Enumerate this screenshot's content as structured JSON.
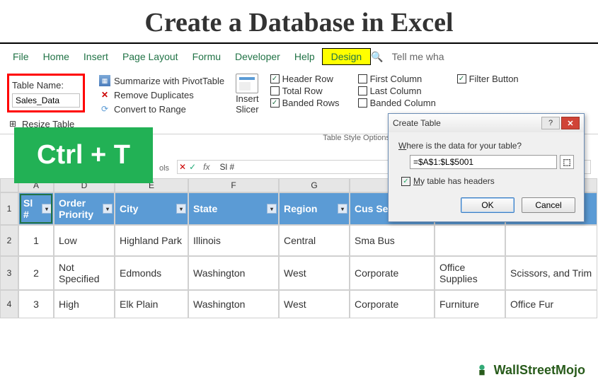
{
  "title": "Create a Database in Excel",
  "ribbon_tabs": [
    "File",
    "Home",
    "Insert",
    "Page Layout",
    "Formu",
    "Developer",
    "Help",
    "Design"
  ],
  "tellme": "Tell me wha",
  "table_name": {
    "label": "Table Name:",
    "value": "Sales_Data",
    "resize": "Resize Table"
  },
  "tools": {
    "pivot": "Summarize with PivotTable",
    "dup": "Remove Duplicates",
    "range": "Convert to Range",
    "group": "ols"
  },
  "slicer": {
    "top": "Insert",
    "bottom": "Slicer"
  },
  "style_options": {
    "header_row": "Header Row",
    "total_row": "Total Row",
    "banded_rows": "Banded Rows",
    "first_col": "First Column",
    "last_col": "Last Column",
    "banded_col": "Banded Column",
    "filter_btn": "Filter Button",
    "group": "Table Style Options"
  },
  "shortcut": "Ctrl + T",
  "formula": {
    "fx": "fx",
    "value": "Sl #"
  },
  "col_letters": [
    "A",
    "D",
    "E",
    "F",
    "G"
  ],
  "row_nums": [
    "1",
    "2",
    "3",
    "4"
  ],
  "headers": [
    "Sl #",
    "Order Priority",
    "City",
    "State",
    "Region",
    "Cus\nSeg",
    "",
    ""
  ],
  "rows": [
    [
      "1",
      "Low",
      "Highland Park",
      "Illinois",
      "Central",
      "Sma\nBus",
      "",
      ""
    ],
    [
      "2",
      "Not Specified",
      "Edmonds",
      "Washington",
      "West",
      "Corporate",
      "Office Supplies",
      "Scissors, and Trim"
    ],
    [
      "3",
      "High",
      "Elk Plain",
      "Washington",
      "West",
      "Corporate",
      "Furniture",
      "Office Fur"
    ]
  ],
  "dialog": {
    "title": "Create Table",
    "question_pre": "W",
    "question_rest": "here is the data for your table?",
    "range": "=$A$1:$L$5001",
    "headers_pre": "M",
    "headers_rest": "y table has headers",
    "ok": "OK",
    "cancel": "Cancel"
  },
  "watermark": "WallStreetMojo"
}
